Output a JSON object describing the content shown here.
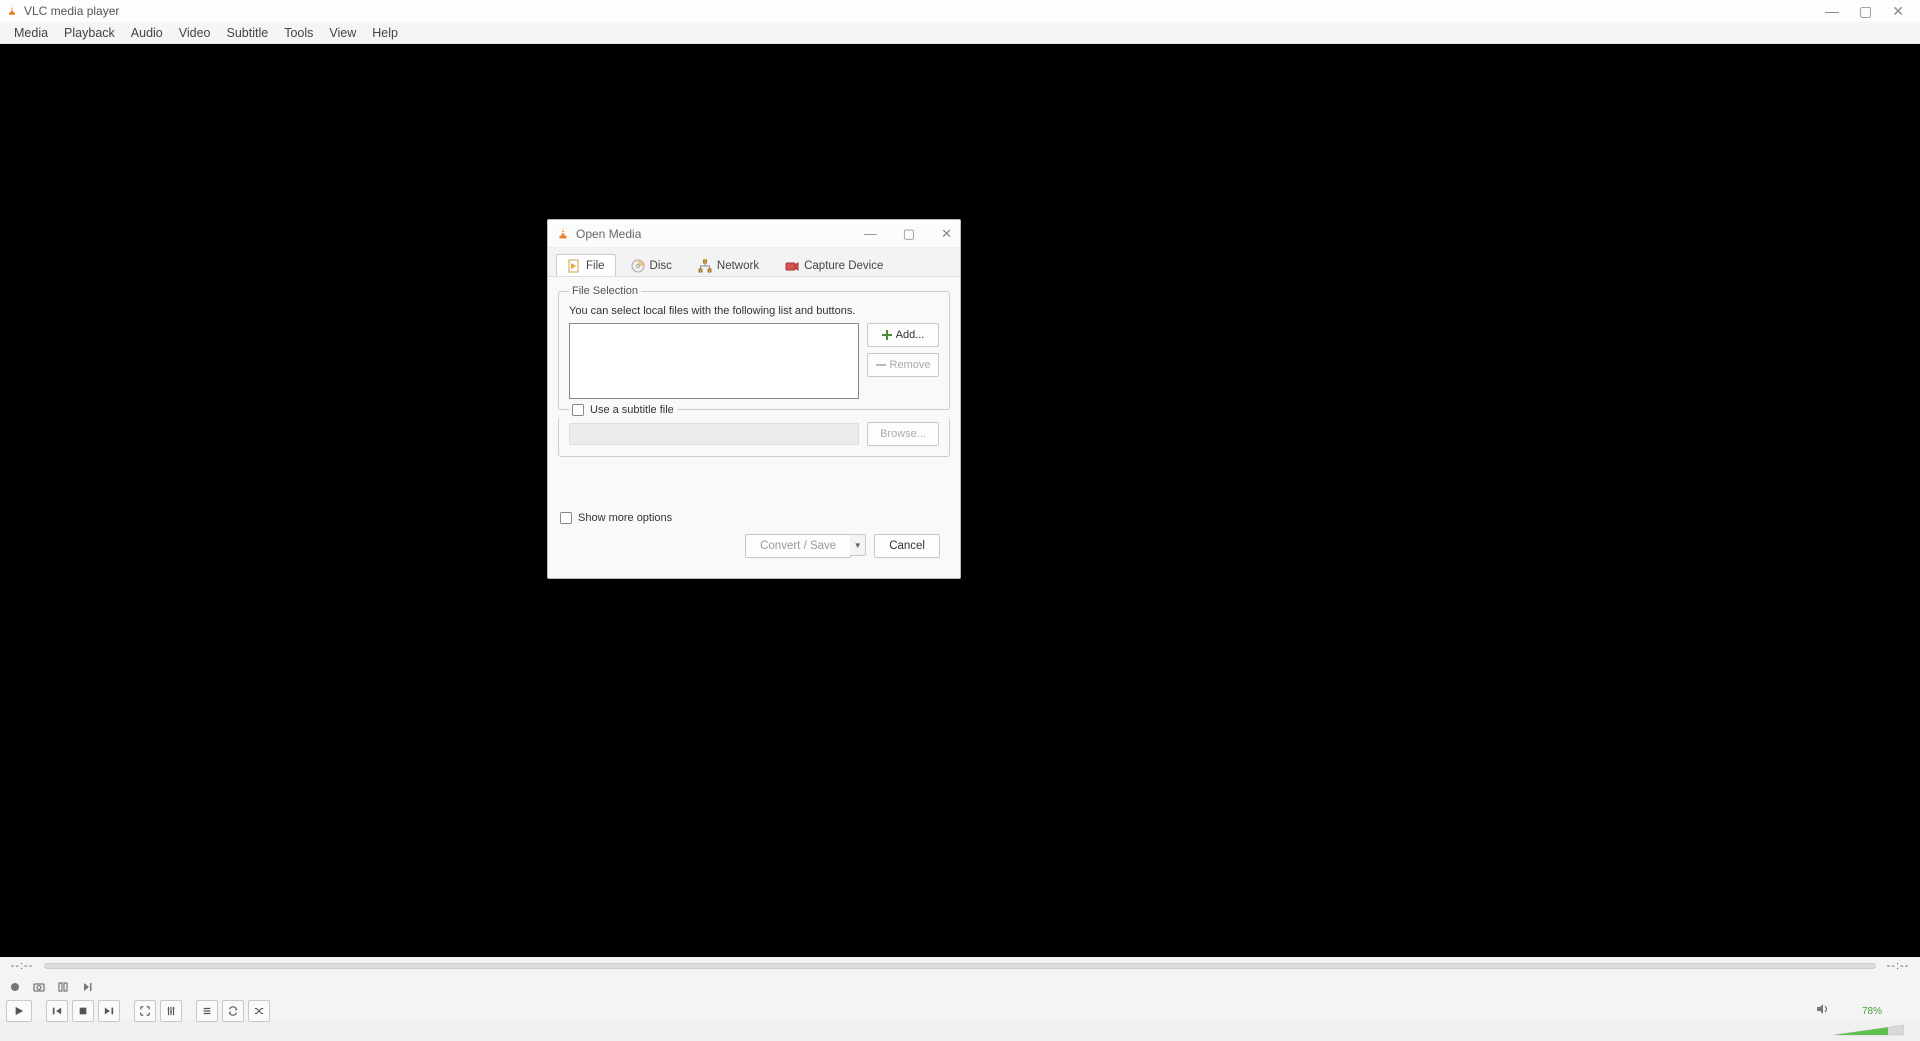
{
  "app": {
    "title": "VLC media player"
  },
  "menubar": {
    "items": [
      "Media",
      "Playback",
      "Audio",
      "Video",
      "Subtitle",
      "Tools",
      "View",
      "Help"
    ]
  },
  "bottom": {
    "time_elapsed": "--:--",
    "time_total": "--:--",
    "volume_label": "78%"
  },
  "dialog": {
    "title": "Open Media",
    "tabs": {
      "file": "File",
      "disc": "Disc",
      "network": "Network",
      "capture": "Capture Device"
    },
    "file_selection": {
      "legend": "File Selection",
      "hint": "You can select local files with the following list and buttons.",
      "add_label": "Add...",
      "remove_label": "Remove"
    },
    "subtitle": {
      "checkbox_label": "Use a subtitle file",
      "browse_label": "Browse..."
    },
    "more_options_label": "Show more options",
    "convert_label": "Convert / Save",
    "cancel_label": "Cancel"
  }
}
